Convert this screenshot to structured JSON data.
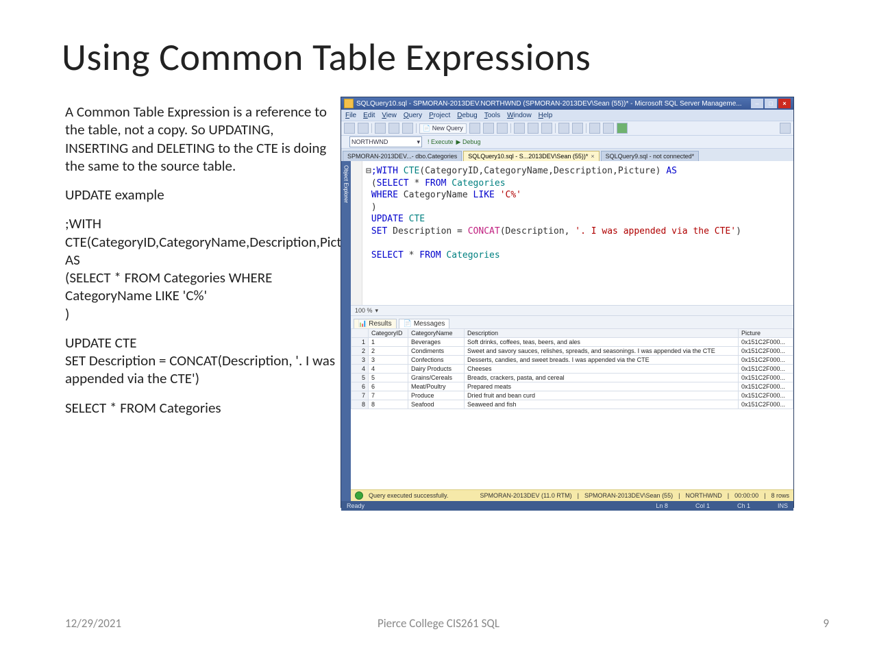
{
  "slide": {
    "title": "Using Common Table Expressions",
    "intro": "A Common Table Expression is a reference to the table, not a copy. So UPDATING, INSERTING and DELETING to the CTE is doing the same to the source table.",
    "subhead": "UPDATE example",
    "code1": ";WITH CTE(CategoryID,CategoryName,Description,Picture) AS\n(SELECT * FROM Categories WHERE CategoryName LIKE 'C%'\n)",
    "code2": "UPDATE CTE\nSET Description = CONCAT(Description, '. I was appended via the CTE')",
    "code3": "SELECT * FROM Categories"
  },
  "footer": {
    "date": "12/29/2021",
    "center": "Pierce College CIS261 SQL",
    "page": "9"
  },
  "ssms": {
    "window_title": "SQLQuery10.sql - SPMORAN-2013DEV.NORTHWND (SPMORAN-2013DEV\\Sean (55))* - Microsoft SQL Server Manageme...",
    "menu": [
      "File",
      "Edit",
      "View",
      "Query",
      "Project",
      "Debug",
      "Tools",
      "Window",
      "Help"
    ],
    "new_query_label": "New Query",
    "db_selected": "NORTHWND",
    "execute_label": "Execute",
    "debug_label": "Debug",
    "tabs": {
      "inactive1": "SPMORAN-2013DEV...- dbo.Categories",
      "active": "SQLQuery10.sql - S...2013DEV\\Sean (55))*",
      "inactive2": "SQLQuery9.sql - not connected*"
    },
    "object_explorer_label": "Object Explorer",
    "zoom": "100 %",
    "result_tabs": {
      "results": "Results",
      "messages": "Messages"
    },
    "columns": [
      "CategoryID",
      "CategoryName",
      "Description",
      "Picture"
    ],
    "rows": [
      {
        "n": "1",
        "id": "1",
        "name": "Beverages",
        "desc": "Soft drinks, coffees, teas, beers, and ales",
        "pic": "0x151C2F000..."
      },
      {
        "n": "2",
        "id": "2",
        "name": "Condiments",
        "desc": "Sweet and savory sauces, relishes, spreads, and seasonings. I was appended via the CTE",
        "pic": "0x151C2F000..."
      },
      {
        "n": "3",
        "id": "3",
        "name": "Confections",
        "desc": "Desserts, candies, and sweet breads. I was appended via the CTE",
        "pic": "0x151C2F000..."
      },
      {
        "n": "4",
        "id": "4",
        "name": "Dairy Products",
        "desc": "Cheeses",
        "pic": "0x151C2F000..."
      },
      {
        "n": "5",
        "id": "5",
        "name": "Grains/Cereals",
        "desc": "Breads, crackers, pasta, and cereal",
        "pic": "0x151C2F000..."
      },
      {
        "n": "6",
        "id": "6",
        "name": "Meat/Poultry",
        "desc": "Prepared meats",
        "pic": "0x151C2F000..."
      },
      {
        "n": "7",
        "id": "7",
        "name": "Produce",
        "desc": "Dried fruit and bean curd",
        "pic": "0x151C2F000..."
      },
      {
        "n": "8",
        "id": "8",
        "name": "Seafood",
        "desc": "Seaweed and fish",
        "pic": "0x151C2F000..."
      }
    ],
    "status": {
      "msg": "Query executed successfully.",
      "server": "SPMORAN-2013DEV (11.0 RTM)",
      "user": "SPMORAN-2013DEV\\Sean (55)",
      "db": "NORTHWND",
      "time": "00:00:00",
      "rows": "8 rows"
    },
    "bottom": {
      "ready": "Ready",
      "ln": "Ln 8",
      "col": "Col 1",
      "ch": "Ch 1",
      "ins": "INS"
    }
  }
}
